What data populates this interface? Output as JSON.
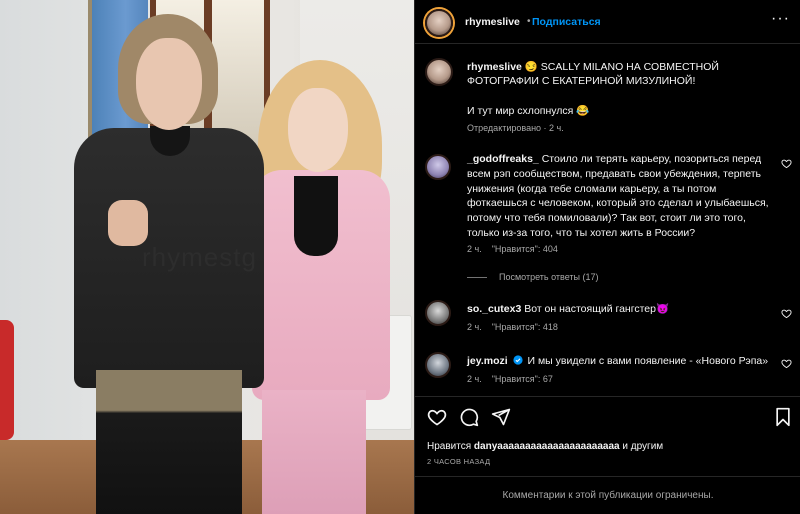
{
  "header": {
    "username": "rhymeslive",
    "separator": "•",
    "follow_label": "Подписаться",
    "more_label": "···"
  },
  "caption": {
    "username": "rhymeslive",
    "text": "😏 SCALLY MILANO НА СОВМЕСТНОЙ ФОТОГРАФИИ С ЕКАТЕРИНОЙ МИЗУЛИНОЙ!",
    "line2": "И тут мир схлопнулся 😂",
    "meta": "Отредактировано · 2 ч."
  },
  "photo": {
    "watermark": "rhymestg"
  },
  "comments": [
    {
      "username": "_godoffreaks_",
      "text": "Стоило ли терять карьеру, позориться перед всем рэп сообществом, предавать свои убеждения, терпеть унижения (когда тебе сломали карьеру, а ты потом фоткаешься с человеком, который это сделал и улыбаешься, потому что тебя помиловали)? Так вот, стоит ли это того, только из-за того, что ты хотел жить в России?",
      "time": "2 ч.",
      "likes": "\"Нравится\": 404"
    },
    {
      "username": "so._cutex3",
      "text": "Вот он настоящий гангстер😈",
      "time": "2 ч.",
      "likes": "\"Нравится\": 418"
    },
    {
      "username": "jey.mozi",
      "verified": true,
      "text": "И мы увидели с вами появление - «Нового Рэпа»",
      "time": "2 ч.",
      "likes": "\"Нравится\": 67"
    }
  ],
  "replies_label": "Посмотреть ответы (17)",
  "likes": {
    "prefix": "Нравится",
    "user": "danyaaaaaaaaaaaaaaaaaaaaaa",
    "suffix": "и другим"
  },
  "timestamp": "2 ЧАСОВ НАЗАД",
  "footer": "Комментарии к этой публикации ограничены.",
  "colors": {
    "background": "#000000",
    "accent": "#0095f6",
    "muted": "#a8a8a8"
  }
}
